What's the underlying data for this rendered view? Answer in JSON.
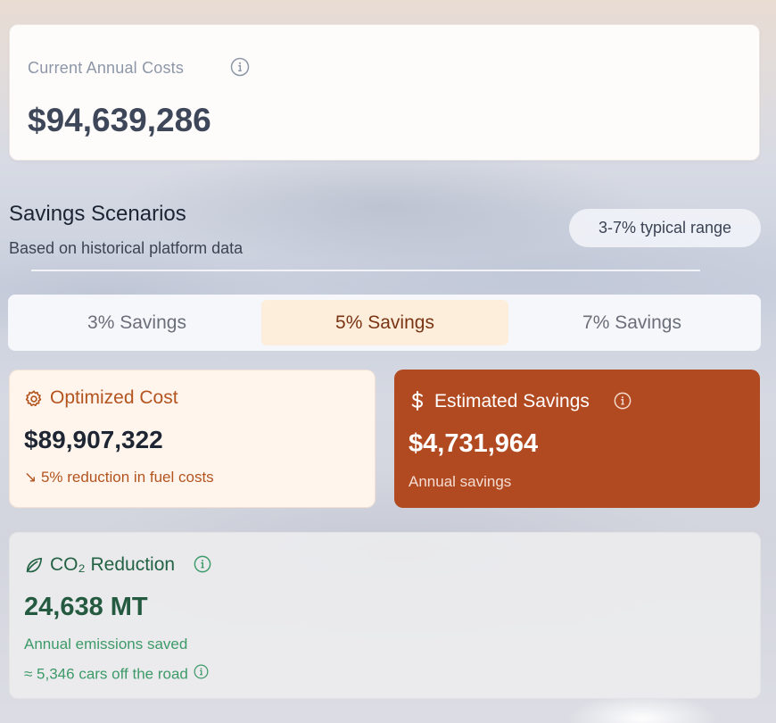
{
  "current_costs": {
    "label": "Current Annual Costs",
    "value": "$94,639,286",
    "info_icon": "info-circle-icon"
  },
  "scenarios": {
    "title": "Savings Scenarios",
    "subtitle": "Based on historical platform data",
    "range_badge": "3-7% typical range",
    "tabs": [
      {
        "label": "3% Savings",
        "selected": false
      },
      {
        "label": "5% Savings",
        "selected": true
      },
      {
        "label": "7% Savings",
        "selected": false
      }
    ]
  },
  "optimized": {
    "icon": "gear-icon",
    "title": "Optimized Cost",
    "value": "$89,907,322",
    "note": "↘ 5% reduction in fuel costs"
  },
  "savings": {
    "icon": "dollar-icon",
    "title": "Estimated Savings",
    "value": "$4,731,964",
    "note": "Annual savings"
  },
  "co2": {
    "icon": "leaf-icon",
    "title": "CO₂ Reduction",
    "value": "24,638 MT",
    "note": "Annual emissions saved",
    "cars": "≈ 5,346 cars off the road"
  },
  "colors": {
    "accent": "#b24a21",
    "selected_tab_bg": "#fdeedb",
    "green": "#236244",
    "orange_text": "#b3541f"
  }
}
